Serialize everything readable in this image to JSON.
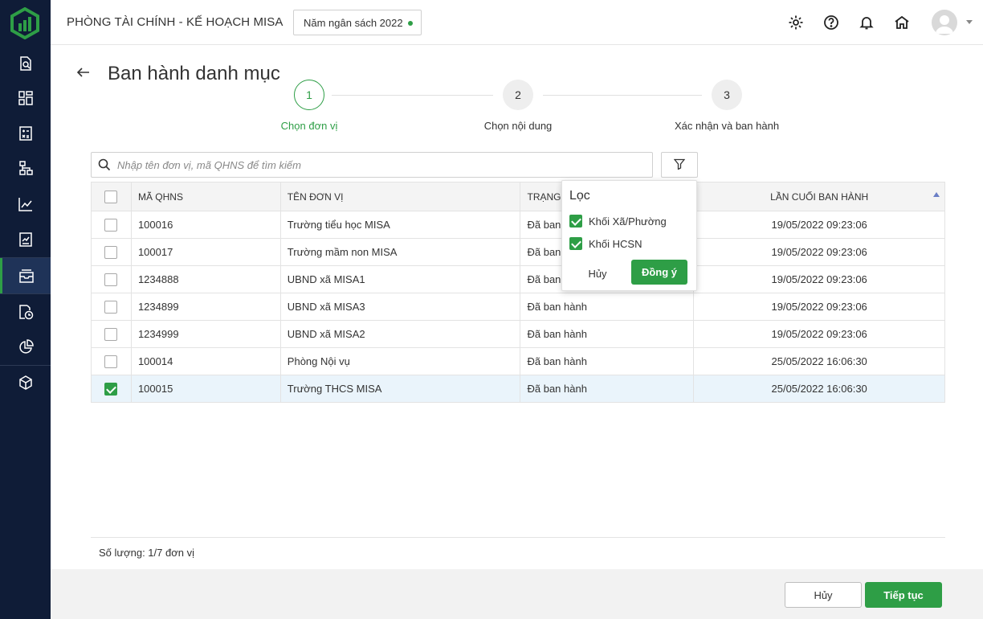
{
  "header": {
    "app_title": "PHÒNG TÀI CHÍNH - KẾ HOẠCH MISA",
    "year_selector": "Năm ngân sách 2022",
    "icons": [
      "settings-icon",
      "help-icon",
      "bell-icon",
      "home-icon",
      "avatar"
    ]
  },
  "sidebar": {
    "items": [
      "search-doc-icon",
      "dashboard-icon",
      "calculator-icon",
      "sitemap-icon",
      "chart-line-icon",
      "report-icon",
      "inbox-icon",
      "clock-file-icon",
      "pie-chart-icon",
      "cube-icon"
    ],
    "active_index": 6
  },
  "page": {
    "title": "Ban hành danh mục"
  },
  "steps": [
    {
      "number": "1",
      "label": "Chọn đơn vị",
      "active": true
    },
    {
      "number": "2",
      "label": "Chọn nội dung",
      "active": false
    },
    {
      "number": "3",
      "label": "Xác nhận và ban hành",
      "active": false
    }
  ],
  "search": {
    "placeholder": "Nhập tên đơn vị, mã QHNS để tìm kiếm"
  },
  "table": {
    "columns": [
      "MÃ QHNS",
      "TÊN ĐƠN VỊ",
      "TRẠNG",
      "LẦN CUỐI BAN HÀNH"
    ],
    "rows": [
      {
        "code": "100016",
        "name": "Trường tiểu học MISA",
        "status": "Đã ban",
        "last": "19/05/2022 09:23:06",
        "checked": false
      },
      {
        "code": "100017",
        "name": "Trường mầm non MISA",
        "status": "Đã ban",
        "last": "19/05/2022 09:23:06",
        "checked": false
      },
      {
        "code": "1234888",
        "name": "UBND xã MISA1",
        "status": "Đã ban",
        "last": "19/05/2022 09:23:06",
        "checked": false
      },
      {
        "code": "1234899",
        "name": "UBND xã MISA3",
        "status": "Đã ban hành",
        "last": "19/05/2022 09:23:06",
        "checked": false
      },
      {
        "code": "1234999",
        "name": "UBND xã MISA2",
        "status": "Đã ban hành",
        "last": "19/05/2022 09:23:06",
        "checked": false
      },
      {
        "code": "100014",
        "name": "Phòng Nội vụ",
        "status": "Đã ban hành",
        "last": "25/05/2022 16:06:30",
        "checked": false
      },
      {
        "code": "100015",
        "name": "Trường THCS MISA",
        "status": "Đã ban hành",
        "last": "25/05/2022 16:06:30",
        "checked": true
      }
    ]
  },
  "filter_popup": {
    "title": "Lọc",
    "options": [
      {
        "label": "Khối Xã/Phường",
        "checked": true
      },
      {
        "label": "Khối HCSN",
        "checked": true
      }
    ],
    "cancel": "Hủy",
    "ok": "Đồng ý"
  },
  "summary": {
    "count": "Số lượng: 1/7 đơn vị"
  },
  "footer": {
    "cancel": "Hủy",
    "next": "Tiếp tục"
  },
  "colors": {
    "accent": "#2e9e46",
    "sidebar": "#0f1c37"
  }
}
